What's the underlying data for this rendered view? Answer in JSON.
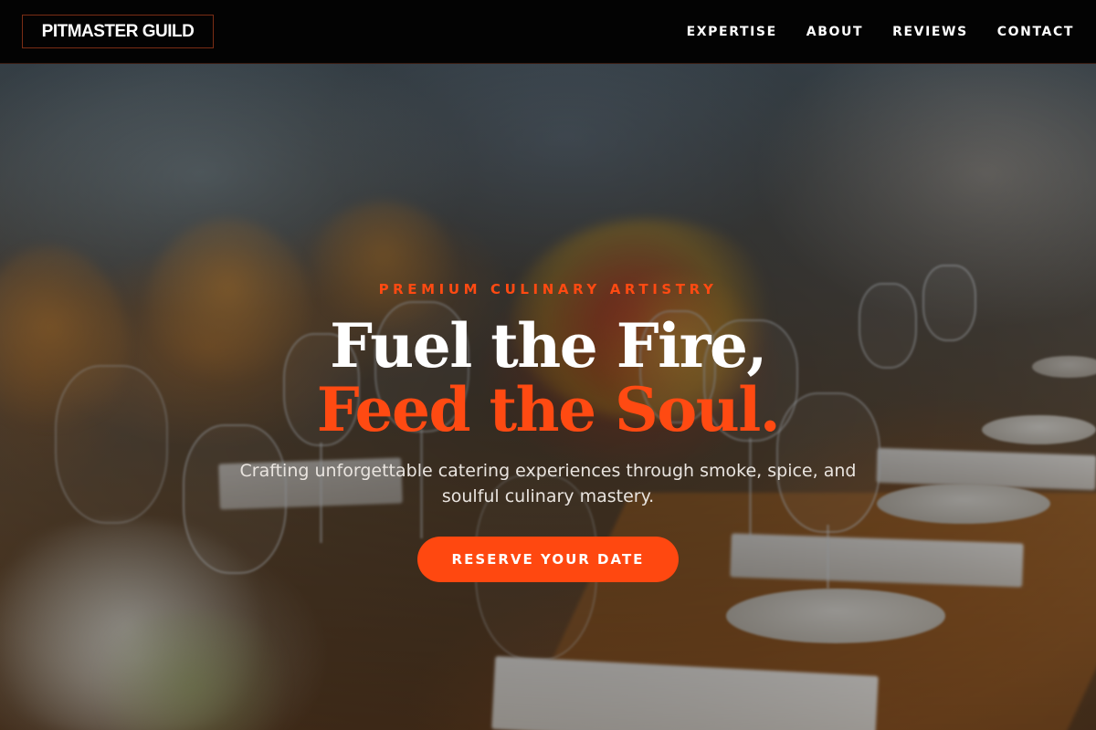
{
  "header": {
    "logo_text": "PITMASTER GUILD",
    "nav_items": [
      {
        "label": "EXPERTISE"
      },
      {
        "label": "ABOUT"
      },
      {
        "label": "REVIEWS"
      },
      {
        "label": "CONTACT"
      }
    ]
  },
  "hero": {
    "eyebrow": "PREMIUM CULINARY ARTISTRY",
    "headline_line1": "Fuel the Fire,",
    "headline_line2": "Feed the Soul.",
    "subheadline": "Crafting unforgettable catering experiences through smoke, spice, and soulful culinary mastery.",
    "cta_label": "RESERVE YOUR DATE",
    "background_scene": "dining-table-banquet-photo"
  },
  "colors": {
    "accent": "#ff4a12",
    "nav_background": "#030303",
    "text_light": "#ffffff"
  }
}
